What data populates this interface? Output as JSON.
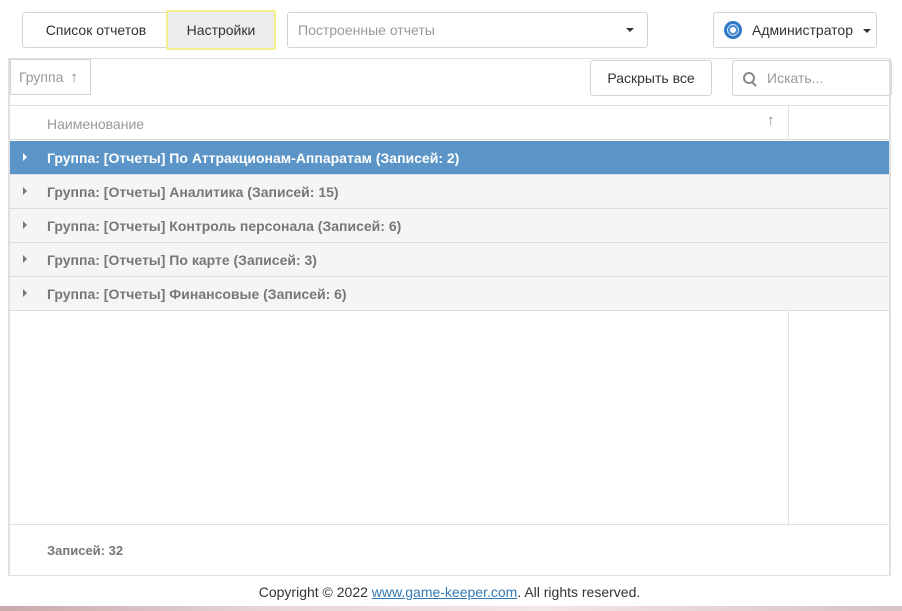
{
  "toolbar": {
    "tab_list_label": "Список отчетов",
    "tab_settings_label": "Настройки",
    "report_select_placeholder": "Построенные отчеты",
    "user_name": "Администратор"
  },
  "grid": {
    "group_panel_label": "Группа",
    "expand_all_label": "Раскрыть все",
    "search_placeholder": "Искать...",
    "columns": [
      {
        "label": "Наименование"
      }
    ],
    "groups": [
      {
        "label": "Группа: [Отчеты] По Аттракционам-Аппаратам (Записей: 2)",
        "selected": true
      },
      {
        "label": "Группа: [Отчеты] Аналитика (Записей: 15)",
        "selected": false
      },
      {
        "label": "Группа: [Отчеты] Контроль персонала (Записей: 6)",
        "selected": false
      },
      {
        "label": "Группа: [Отчеты] По карте (Записей: 3)",
        "selected": false
      },
      {
        "label": "Группа: [Отчеты] Финансовые (Записей: 6)",
        "selected": false
      }
    ],
    "footer_summary": "Записей: 32"
  },
  "footer": {
    "copyright_prefix": "Copyright © 2022 ",
    "link_text": "www.game-keeper.com",
    "copyright_suffix": ". All rights reserved."
  },
  "icons": {
    "sort": "sort-ascending-icon",
    "search": "search-icon",
    "user": "user-avatar-icon",
    "dropdown": "chevron-down-icon",
    "expander": "expand-arrow-icon"
  },
  "colors": {
    "selected_row": "#5b95c7",
    "highlight_border": "#f3f08a",
    "link": "#337ab7"
  }
}
